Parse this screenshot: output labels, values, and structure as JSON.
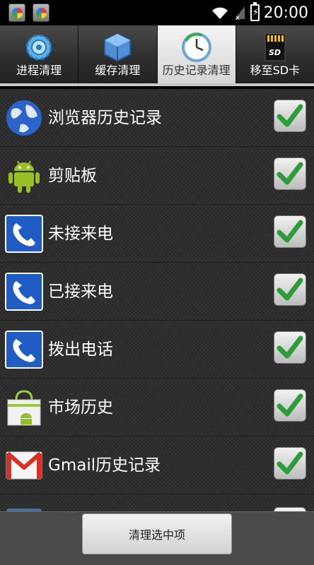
{
  "status_bar": {
    "time": "20:00"
  },
  "tabs": [
    {
      "label": "进程清理",
      "icon": "gear-icon",
      "active": false
    },
    {
      "label": "缓存清理",
      "icon": "cube-icon",
      "active": false
    },
    {
      "label": "历史记录清理",
      "icon": "clock-icon",
      "active": true
    },
    {
      "label": "移至SD卡",
      "icon": "sd-card-icon",
      "active": false
    }
  ],
  "list": [
    {
      "label": "浏览器历史记录",
      "icon": "globe-icon",
      "checked": true
    },
    {
      "label": "剪贴板",
      "icon": "android-icon",
      "checked": true
    },
    {
      "label": "未接来电",
      "icon": "phone-icon",
      "checked": true
    },
    {
      "label": "已接来电",
      "icon": "phone-icon",
      "checked": true
    },
    {
      "label": "拨出电话",
      "icon": "phone-icon",
      "checked": true
    },
    {
      "label": "市场历史",
      "icon": "market-icon",
      "checked": true
    },
    {
      "label": "Gmail历史记录",
      "icon": "gmail-icon",
      "checked": true
    }
  ],
  "footer": {
    "clear_button": "清理选中项"
  },
  "colors": {
    "check_green": "#2e9c3a",
    "active_tab": "#e6e6e6"
  }
}
